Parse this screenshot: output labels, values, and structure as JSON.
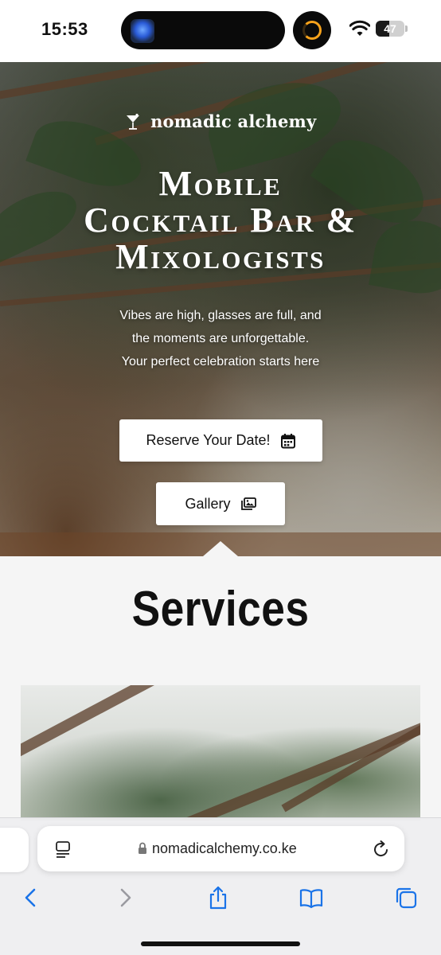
{
  "status_bar": {
    "time": "15:53",
    "battery_level": "47",
    "battery_fraction": 0.47
  },
  "hero": {
    "logo_text": "nomadic alchemy",
    "title_line_1": "Mobile",
    "title_line_2": "Cocktail Bar &",
    "title_line_3": "Mixologists",
    "tagline_line_1": "Vibes are high, glasses are full, and",
    "tagline_line_2": "the moments are unforgettable.",
    "tagline_line_3": "Your perfect celebration starts here",
    "reserve_label": "Reserve Your Date!",
    "gallery_label": "Gallery"
  },
  "services": {
    "heading": "Services"
  },
  "browser": {
    "url": "nomadicalchemy.co.ke"
  },
  "icons": {
    "logo": "cocktail-glass-icon",
    "reserve": "calendar-icon",
    "gallery": "images-icon",
    "lock": "lock-icon",
    "reader": "page-menu-icon",
    "reload": "reload-icon",
    "back": "chevron-left-icon",
    "forward": "chevron-right-icon",
    "share": "share-icon",
    "bookmarks": "book-icon",
    "tabs": "tabs-icon"
  },
  "colors": {
    "accent": "#1a73e8",
    "hero_text": "#ffffff",
    "timer": "#f7a21b"
  }
}
